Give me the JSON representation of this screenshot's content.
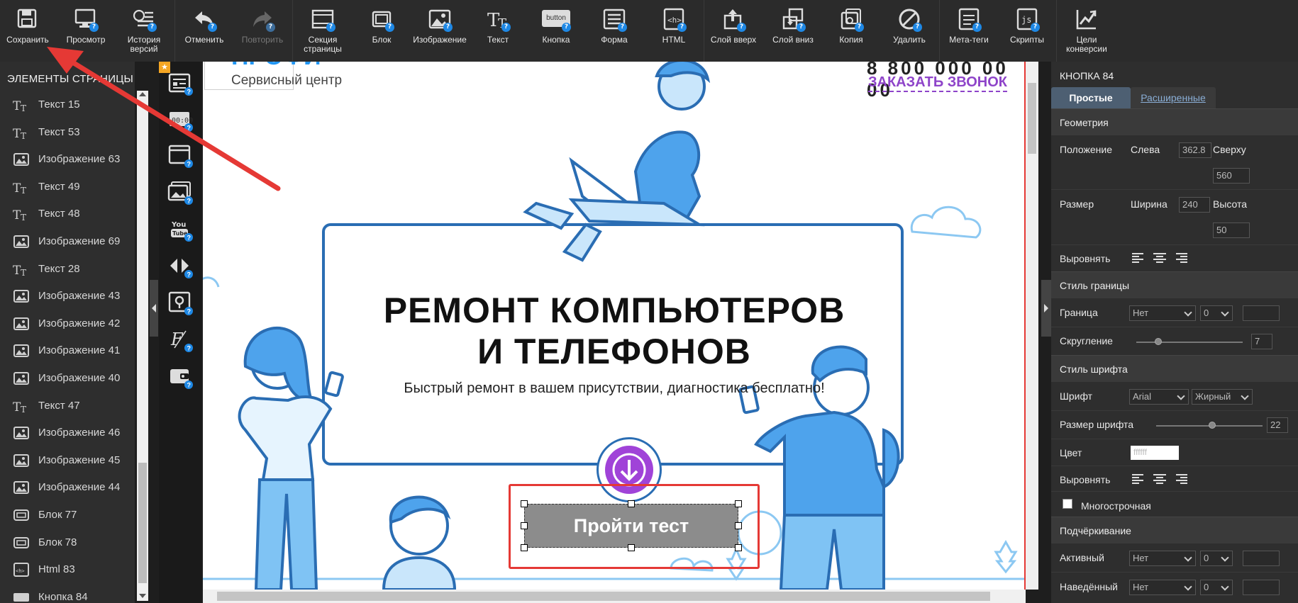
{
  "toolbar": {
    "save": "Сохранить",
    "preview": "Просмотр",
    "history": "История\nверсий",
    "undo": "Отменить",
    "redo": "Повторить",
    "section": "Секция\nстраницы",
    "block": "Блок",
    "image": "Изображение",
    "text": "Текст",
    "button": "Кнопка",
    "button_icon_text": "button",
    "form": "Форма",
    "html": "HTML",
    "layer_up": "Слой вверх",
    "layer_down": "Слой вниз",
    "copy": "Копия",
    "delete": "Удалить",
    "meta": "Мета-теги",
    "scripts": "Скрипты",
    "conversion": "Цели\nконверсии"
  },
  "left_panel": {
    "title": "ЭЛЕМЕНТЫ СТРАНИЦЫ",
    "items": [
      {
        "type": "text",
        "label": "Текст 15"
      },
      {
        "type": "text",
        "label": "Текст 53"
      },
      {
        "type": "image",
        "label": "Изображение 63"
      },
      {
        "type": "text",
        "label": "Текст 49"
      },
      {
        "type": "text",
        "label": "Текст 48"
      },
      {
        "type": "image",
        "label": "Изображение 69"
      },
      {
        "type": "text",
        "label": "Текст 28"
      },
      {
        "type": "image",
        "label": "Изображение 43"
      },
      {
        "type": "image",
        "label": "Изображение 42"
      },
      {
        "type": "image",
        "label": "Изображение 41"
      },
      {
        "type": "image",
        "label": "Изображение 40"
      },
      {
        "type": "text",
        "label": "Текст 47"
      },
      {
        "type": "image",
        "label": "Изображение 46"
      },
      {
        "type": "image",
        "label": "Изображение 45"
      },
      {
        "type": "image",
        "label": "Изображение 44"
      },
      {
        "type": "block",
        "label": "Блок 77"
      },
      {
        "type": "block",
        "label": "Блок 78"
      },
      {
        "type": "html",
        "label": "Html 83"
      },
      {
        "type": "button",
        "label": "Кнопка 84"
      }
    ]
  },
  "canvas": {
    "logo": "ПРОФИ",
    "subtitle_logo": "Сервисный центр",
    "phone": "8 800 000 00 00",
    "call_link": "ЗАКАЗАТЬ ЗВОНОК",
    "hero_line1": "РЕМОНТ КОМПЬЮТЕРОВ",
    "hero_line2": "И ТЕЛЕФОНОВ",
    "hero_sub": "Быстрый ремонт в вашем присутствии, диагностика бесплатно!",
    "cta": "Пройти тест"
  },
  "right_panel": {
    "title": "КНОПКА 84",
    "tab_simple": "Простые",
    "tab_advanced": "Расширенные",
    "geometry": "Геометрия",
    "position": "Положение",
    "left_label": "Слева",
    "left_value": "362.8",
    "top_label": "Сверху",
    "top_value": "560",
    "size": "Размер",
    "width_label": "Ширина",
    "width_value": "240",
    "height_label": "Высота",
    "height_value": "50",
    "align": "Выровнять",
    "border_style": "Стиль границы",
    "border": "Граница",
    "border_type": "Нет",
    "border_width": "0",
    "rounding": "Скругление",
    "rounding_value": "7",
    "font_style": "Стиль шрифта",
    "font": "Шрифт",
    "font_family": "Arial",
    "font_weight": "Жирный",
    "font_size": "Размер шрифта",
    "font_size_value": "22",
    "color": "Цвет",
    "color_value": "ffffff",
    "text_align": "Выровнять",
    "multiline": "Многострочная",
    "underline": "Подчёркивание",
    "active": "Активный",
    "active_type": "Нет",
    "active_width": "0",
    "hover": "Наведённый",
    "hover_type": "Нет",
    "hover_width": "0"
  },
  "colors": {
    "accent_blue": "#1e88e5",
    "selection_red": "#e53935",
    "purple": "#a043d8",
    "illustration_blue": "#2a6db3"
  }
}
